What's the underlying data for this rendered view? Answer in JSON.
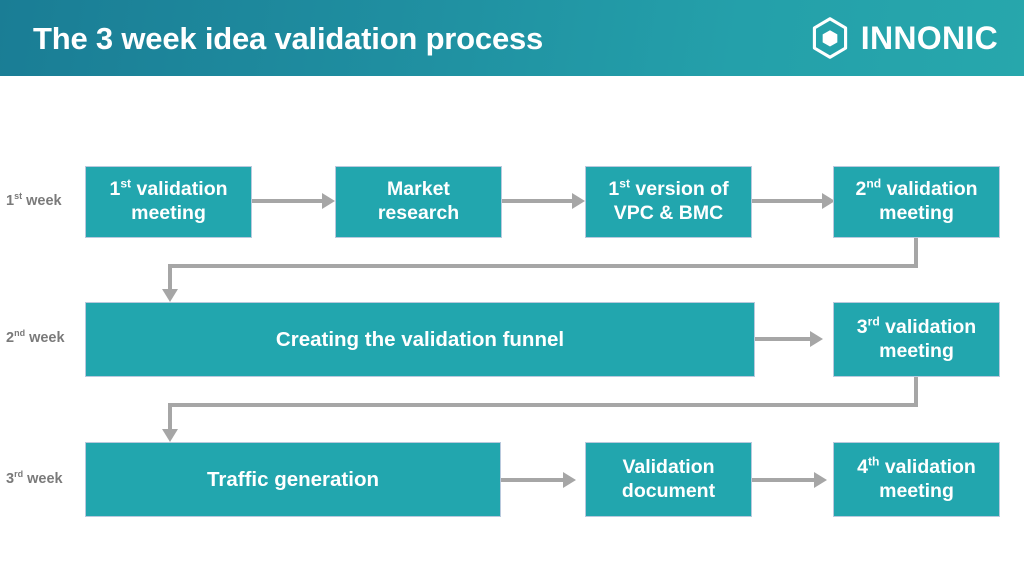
{
  "header": {
    "title": "The 3 week idea validation process",
    "logo_name": "innonic-logo",
    "logo_text": "INNONIC",
    "gradient_from": "#1a7d95",
    "gradient_to": "#27a7ac"
  },
  "theme": {
    "box_fill": "#22a6ae",
    "box_border": "#b9c9dd",
    "box_text": "#ffffff",
    "connector": "#a6a6a6",
    "label_text": "#7a7a7a",
    "background": "#ffffff"
  },
  "rows": [
    {
      "label_prefix": "1",
      "label_sup": "st",
      "label_suffix": " week",
      "label_full": "1st week"
    },
    {
      "label_prefix": "2",
      "label_sup": "nd",
      "label_suffix": " week",
      "label_full": "2nd week"
    },
    {
      "label_prefix": "3",
      "label_sup": "rd",
      "label_suffix": " week",
      "label_full": "3rd week"
    }
  ],
  "boxes": [
    {
      "id": "box-1st-validation-meeting",
      "line1_pre": "1",
      "line1_sup": "st",
      "line1_post": " validation",
      "line2": "meeting",
      "text": "1st validation meeting"
    },
    {
      "id": "box-market-research",
      "line1_pre": "",
      "line1_sup": "",
      "line1_post": "Market",
      "line2": "research",
      "text": "Market research"
    },
    {
      "id": "box-first-version-vpc-bmc",
      "line1_pre": "1",
      "line1_sup": "st",
      "line1_post": " version of",
      "line2": "VPC & BMC",
      "text": "1st version of VPC & BMC"
    },
    {
      "id": "box-2nd-validation-meeting",
      "line1_pre": "2",
      "line1_sup": "nd",
      "line1_post": " validation",
      "line2": "meeting",
      "text": "2nd validation meeting"
    },
    {
      "id": "box-creating-validation-funnel",
      "line1_pre": "",
      "line1_sup": "",
      "line1_post": "Creating the validation funnel",
      "line2": "",
      "text": "Creating the validation funnel"
    },
    {
      "id": "box-3rd-validation-meeting",
      "line1_pre": "3",
      "line1_sup": "rd",
      "line1_post": " validation",
      "line2": "meeting",
      "text": "3rd validation meeting"
    },
    {
      "id": "box-traffic-generation",
      "line1_pre": "",
      "line1_sup": "",
      "line1_post": "Traffic generation",
      "line2": "",
      "text": "Traffic generation"
    },
    {
      "id": "box-validation-document",
      "line1_pre": "",
      "line1_sup": "",
      "line1_post": "Validation",
      "line2": "document",
      "text": "Validation document"
    },
    {
      "id": "box-4th-validation-meeting",
      "line1_pre": "4",
      "line1_sup": "th",
      "line1_post": " validation",
      "line2": "meeting",
      "text": "4th validation meeting"
    }
  ]
}
